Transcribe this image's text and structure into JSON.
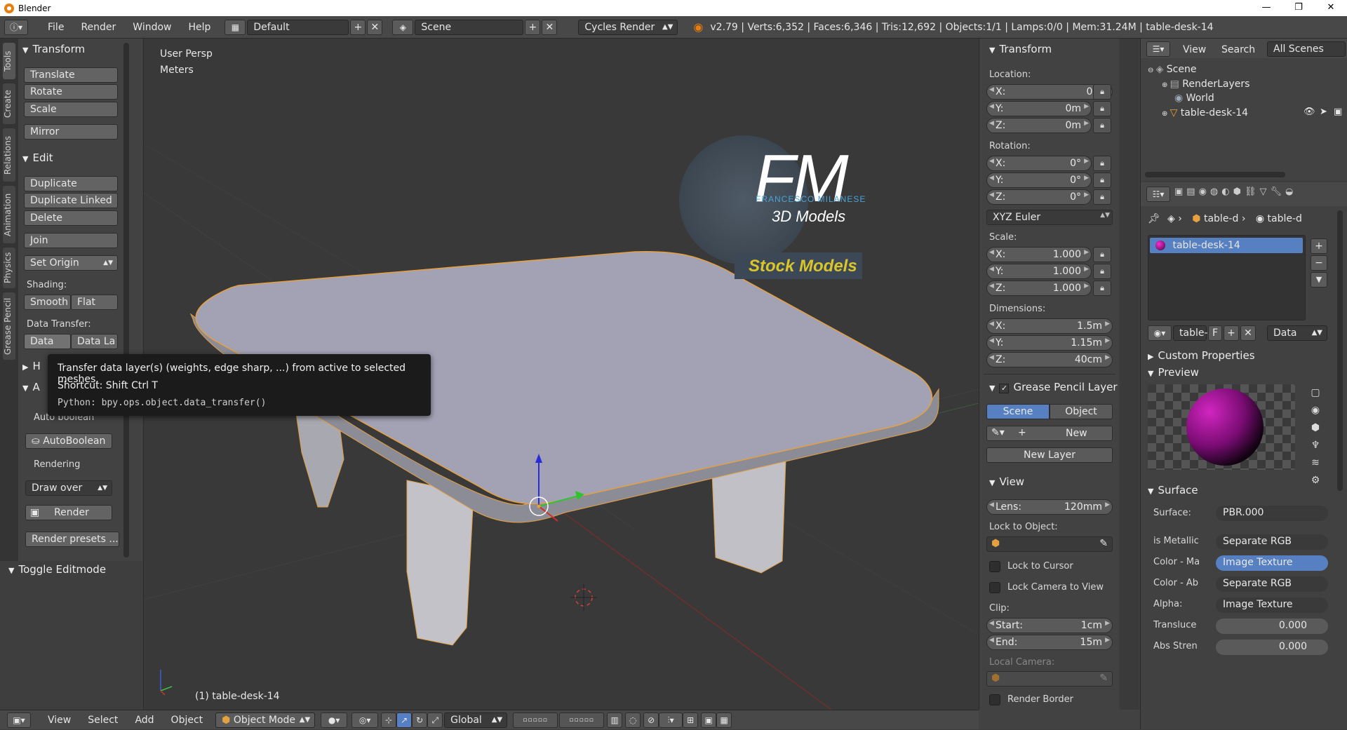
{
  "titlebar": {
    "title": "Blender",
    "min": "—",
    "max": "❐",
    "close": "✕"
  },
  "topbar": {
    "menus": [
      "File",
      "Render",
      "Window",
      "Help"
    ],
    "layout": "Default",
    "scene": "Scene",
    "engine": "Cycles Render",
    "stats": "v2.79 | Verts:6,352 | Faces:6,346 | Tris:12,692 | Objects:1/1 | Lamps:0/0 | Mem:31.24M | table-desk-14"
  },
  "toolshelf": {
    "tabs": [
      "Tools",
      "Create",
      "Relations",
      "Animation",
      "Physics",
      "Grease Pencil"
    ],
    "transform_title": "Transform",
    "translate": "Translate",
    "rotate": "Rotate",
    "scale": "Scale",
    "mirror": "Mirror",
    "edit_title": "Edit",
    "duplicate": "Duplicate",
    "duplicate_linked": "Duplicate Linked",
    "delete": "Delete",
    "join": "Join",
    "set_origin": "Set Origin",
    "shading_label": "Shading:",
    "smooth": "Smooth",
    "flat": "Flat",
    "data_transfer_label": "Data Transfer:",
    "data": "Data",
    "data_la": "Data La",
    "h_header": "H",
    "a_header": "A",
    "auto_boolean_label": "Auto boolean",
    "auto_boolean_btn": "AutoBoolean",
    "rendering_label": "Rendering",
    "draw_over": "Draw over",
    "render": "Render",
    "render_presets": "Render presets ...",
    "toggle_editmode": "Toggle Editmode"
  },
  "viewport": {
    "view_name": "User Persp",
    "units": "Meters",
    "object_label": "(1) table-desk-14",
    "logo_letters": "FM",
    "logo_name": "FRANCESCO MILANESE",
    "logo_sub": "3D Models",
    "logo_banner": "Stock Models"
  },
  "tooltip": {
    "text": "Transfer data layer(s) (weights, edge sharp, ...) from active to selected meshes.",
    "shortcut": "Shortcut: Shift Ctrl T",
    "python": "Python: bpy.ops.object.data_transfer()"
  },
  "properties": {
    "title": "Transform",
    "location_label": "Location:",
    "loc": [
      {
        "k": "X:",
        "v": "0m"
      },
      {
        "k": "Y:",
        "v": "0m"
      },
      {
        "k": "Z:",
        "v": "0m"
      }
    ],
    "rotation_label": "Rotation:",
    "rot": [
      {
        "k": "X:",
        "v": "0°"
      },
      {
        "k": "Y:",
        "v": "0°"
      },
      {
        "k": "Z:",
        "v": "0°"
      }
    ],
    "euler": "XYZ Euler",
    "scale_label": "Scale:",
    "scl": [
      {
        "k": "X:",
        "v": "1.000"
      },
      {
        "k": "Y:",
        "v": "1.000"
      },
      {
        "k": "Z:",
        "v": "1.000"
      }
    ],
    "dimensions_label": "Dimensions:",
    "dim": [
      {
        "k": "X:",
        "v": "1.5m"
      },
      {
        "k": "Y:",
        "v": "1.15m"
      },
      {
        "k": "Z:",
        "v": "40cm"
      }
    ],
    "gp_title": "Grease Pencil Layer",
    "gp_scene": "Scene",
    "gp_object": "Object",
    "gp_new": "New",
    "gp_new_layer": "New Layer",
    "view_title": "View",
    "lens_label": "Lens:",
    "lens": "120mm",
    "lock_obj_label": "Lock to Object:",
    "lock_cursor": "Lock to Cursor",
    "lock_camera": "Lock Camera to View",
    "clip_label": "Clip:",
    "clip_start_label": "Start:",
    "clip_start": "1cm",
    "clip_end_label": "End:",
    "clip_end": "15m",
    "local_camera": "Local Camera:",
    "render_border": "Render Border"
  },
  "outliner": {
    "view": "View",
    "search": "Search",
    "scenes": "All Scenes",
    "items": [
      "Scene",
      "RenderLayers",
      "World",
      "table-desk-14"
    ]
  },
  "material": {
    "crumb1": "table-d",
    "crumb2": "table-d",
    "slot": "table-desk-14",
    "mat_name": "table-",
    "f": "F",
    "data": "Data",
    "custom_props": "Custom Properties",
    "preview": "Preview",
    "surface_title": "Surface",
    "surface_label": "Surface:",
    "surface_value": "PBR.000",
    "rows": [
      {
        "k": "is Metallic",
        "v": "Separate RGB"
      },
      {
        "k": "Color - Ma",
        "v": "Image Texture"
      },
      {
        "k": "Color - Ab",
        "v": "Separate RGB"
      },
      {
        "k": "Alpha:",
        "v": "Image Texture"
      }
    ],
    "translucence_label": "Transluce",
    "translucence": "0.000",
    "abs_label": "Abs Stren",
    "abs": "0.000"
  },
  "bottombar": {
    "menus": [
      "View",
      "Select",
      "Add",
      "Object"
    ],
    "mode": "Object Mode",
    "orientation": "Global"
  },
  "colors": {
    "accent": "#5680c2",
    "selection": "#f5a020",
    "bg": "#393939"
  }
}
